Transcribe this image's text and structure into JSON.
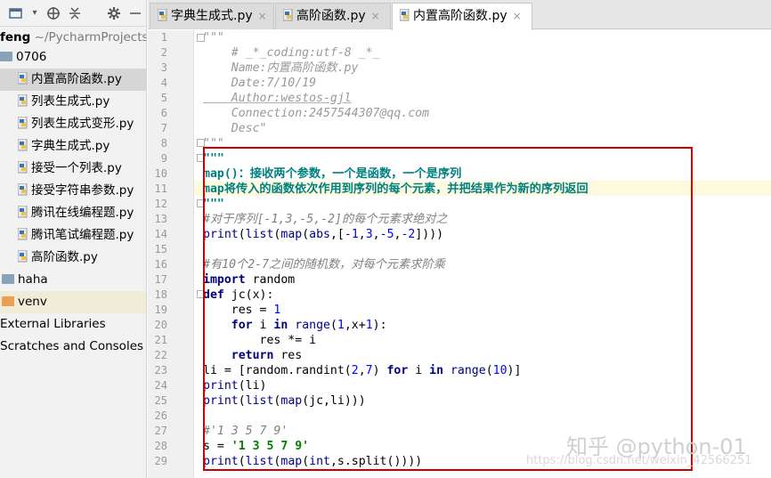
{
  "project": {
    "root_name": "feng",
    "root_path": "~/PycharmProjects/",
    "items": [
      {
        "label": "0706",
        "kind": "folder"
      },
      {
        "label": "内置高阶函数.py",
        "kind": "file"
      },
      {
        "label": "列表生成式.py",
        "kind": "file"
      },
      {
        "label": "列表生成式变形.py",
        "kind": "file"
      },
      {
        "label": "字典生成式.py",
        "kind": "file"
      },
      {
        "label": "接受一个列表.py",
        "kind": "file"
      },
      {
        "label": "接受字符串参数.py",
        "kind": "file"
      },
      {
        "label": "腾讯在线编程题.py",
        "kind": "file"
      },
      {
        "label": "腾讯笔试编程题.py",
        "kind": "file"
      },
      {
        "label": "高阶函数.py",
        "kind": "file"
      },
      {
        "label": "haha",
        "kind": "folder"
      },
      {
        "label": "venv",
        "kind": "folder-orange"
      },
      {
        "label": "External Libraries",
        "kind": "plain"
      },
      {
        "label": "Scratches and Consoles",
        "kind": "plain"
      }
    ]
  },
  "tabs": [
    {
      "label": "字典生成式.py"
    },
    {
      "label": "高阶函数.py"
    },
    {
      "label": "内置高阶函数.py"
    }
  ],
  "tab_close_glyph": "×",
  "line_numbers": [
    "1",
    "2",
    "3",
    "4",
    "5",
    "6",
    "7",
    "8",
    "9",
    "10",
    "11",
    "12",
    "13",
    "14",
    "15",
    "16",
    "17",
    "18",
    "19",
    "20",
    "21",
    "22",
    "23",
    "24",
    "25",
    "26",
    "27",
    "28",
    "29"
  ],
  "code": {
    "l1": "\"\"\"",
    "l2": "    # _*_coding:utf-8 _*_",
    "l3": "    Name:内置高阶函数.py",
    "l4": "    Date:7/10/19",
    "l5": "    Author:westos-gjl",
    "l6": "    Connection:2457544307@qq.com",
    "l7": "    Desc\"",
    "l8": "\"\"\"",
    "l9": "\"\"\"",
    "l10": "map()：接收两个参数，一个是函数，一个是序列",
    "l11": "map将传入的函数依次作用到序列的每个元素，并把结果作为新的序列返回",
    "l12": "\"\"\"",
    "l13a": "#对于序列",
    "l13b": "[-1,3,-5,-2]",
    "l13c": "的每个元素求绝对之",
    "l14a": "print",
    "l14b": "(",
    "l14c": "list",
    "l14d": "(",
    "l14e": "map",
    "l14f": "(",
    "l14g": "abs",
    "l14h": ",[",
    "l14i": "-1",
    "l14j": ",",
    "l14k": "3",
    "l14l": ",",
    "l14m": "-5",
    "l14n": ",",
    "l14o": "-2",
    "l14p": "])))",
    "l16a": "#有",
    "l16b": "10",
    "l16c": "个",
    "l16d": "2-7",
    "l16e": "之间的随机数，对每个元素求阶乘",
    "l17a": "import",
    "l17b": " random",
    "l18a": "def",
    "l18b": " jc(x):",
    "l19a": "    res = ",
    "l19b": "1",
    "l20a": "    for",
    "l20b": " i ",
    "l20c": "in",
    "l20d": " ",
    "l20e": "range",
    "l20f": "(",
    "l20g": "1",
    "l20h": ",x+",
    "l20i": "1",
    "l20j": "):",
    "l21": "        res *= i",
    "l22a": "    return",
    "l22b": " res",
    "l23a": "li = [random.randint(",
    "l23b": "2",
    "l23c": ",",
    "l23d": "7",
    "l23e": ") ",
    "l23f": "for",
    "l23g": " i ",
    "l23h": "in",
    "l23i": " ",
    "l23j": "range",
    "l23k": "(",
    "l23l": "10",
    "l23m": ")]",
    "l24a": "print",
    "l24b": "(li)",
    "l25a": "print",
    "l25b": "(",
    "l25c": "list",
    "l25d": "(",
    "l25e": "map",
    "l25f": "(jc,li)))",
    "l27": "#'1 3 5 7 9'",
    "l28a": "s = ",
    "l28b": "'1 3 5 7 9'",
    "l29a": "print",
    "l29b": "(",
    "l29c": "list",
    "l29d": "(",
    "l29e": "map",
    "l29f": "(",
    "l29g": "int",
    "l29h": ",s.split())))"
  },
  "watermark": {
    "zh": "知乎 @python-01",
    "url": "https://blog.csdn.net/weixin_42566251"
  },
  "colors": {
    "red_box": "#cc0000",
    "current_line": "#fdfae0",
    "selected_tree": "#d6d6d6"
  }
}
